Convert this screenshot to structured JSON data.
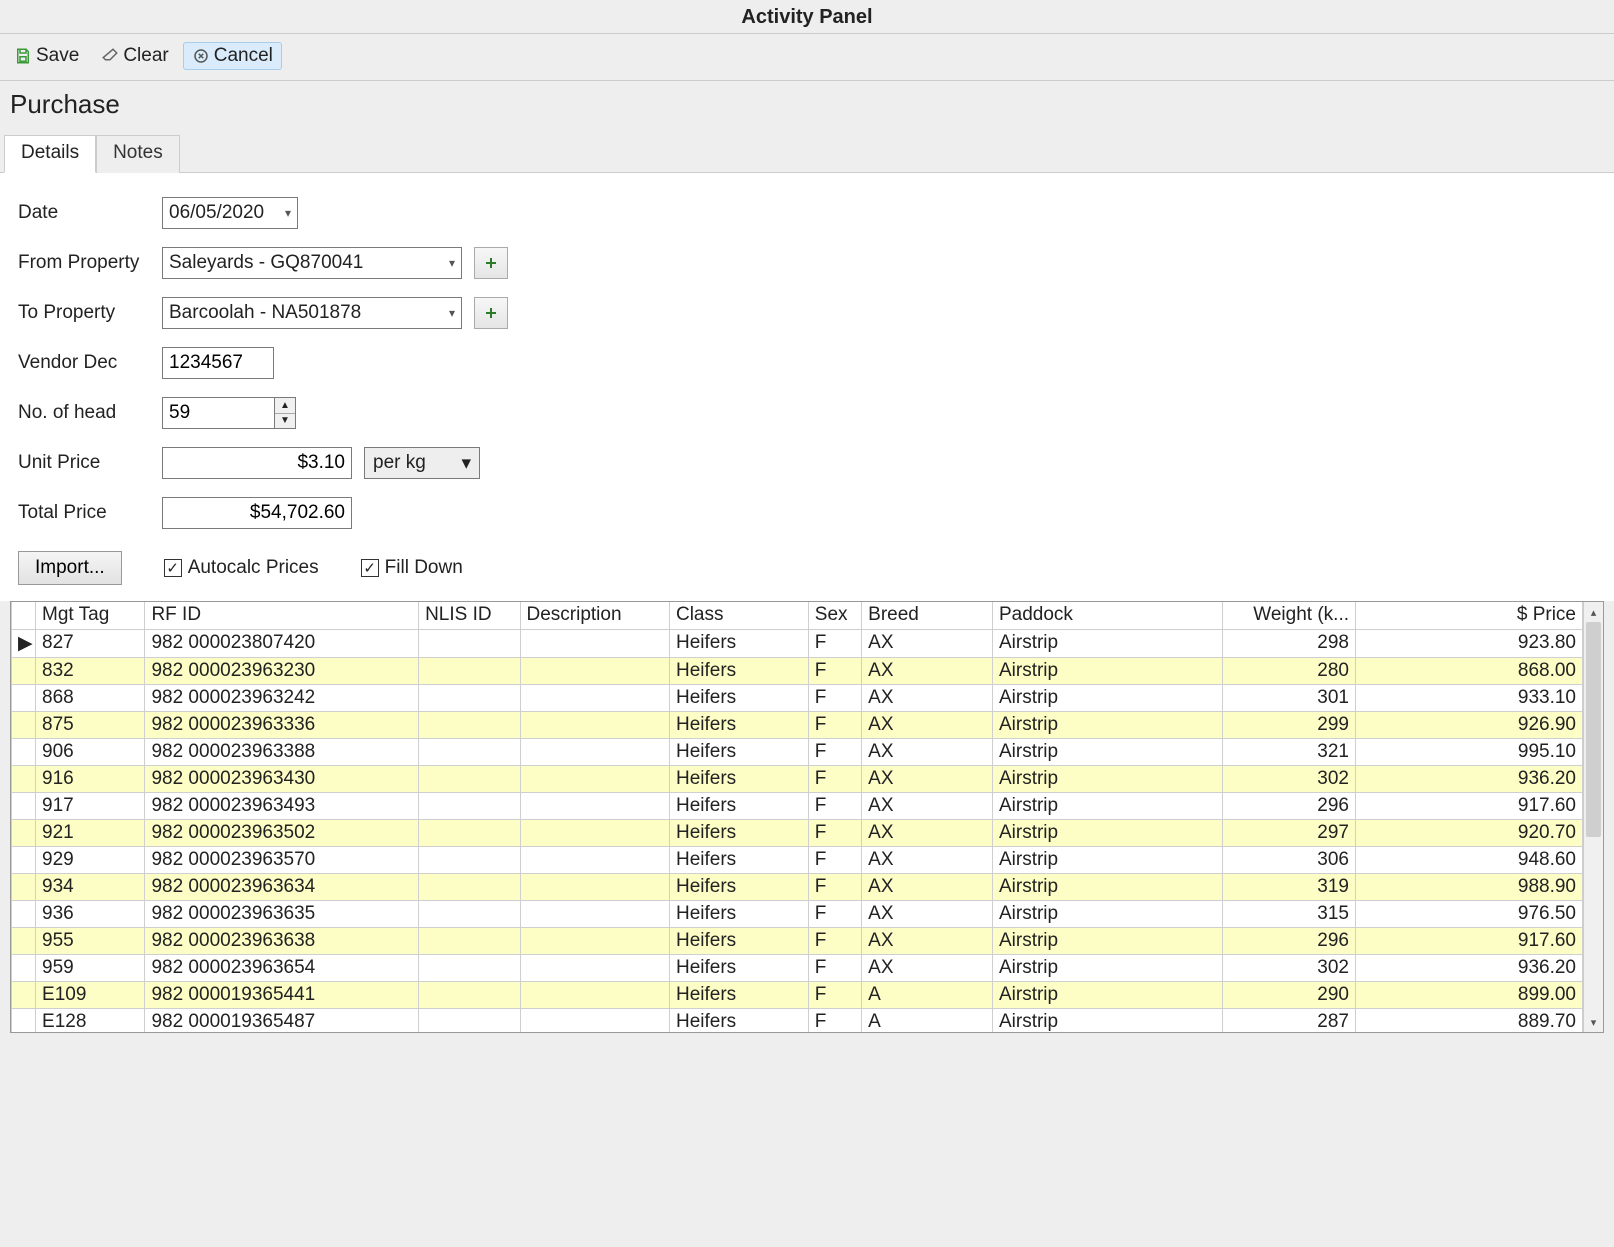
{
  "title": "Activity Panel",
  "toolbar": {
    "save": "Save",
    "clear": "Clear",
    "cancel": "Cancel"
  },
  "subtitle": "Purchase",
  "tabs": {
    "details": "Details",
    "notes": "Notes"
  },
  "form": {
    "date_label": "Date",
    "date_value": "06/05/2020",
    "from_label": "From Property",
    "from_value": "Saleyards - GQ870041",
    "to_label": "To Property",
    "to_value": "Barcoolah - NA501878",
    "vendor_label": "Vendor Dec",
    "vendor_value": "1234567",
    "head_label": "No. of head",
    "head_value": "59",
    "unit_price_label": "Unit Price",
    "unit_price_value": "$3.10",
    "unit_type": "per kg",
    "total_price_label": "Total Price",
    "total_price_value": "$54,702.60"
  },
  "actions": {
    "import": "Import...",
    "autocalc": "Autocalc Prices",
    "filldown": "Fill Down"
  },
  "grid": {
    "headers": {
      "mgt_tag": "Mgt Tag",
      "rf_id": "RF ID",
      "nlis_id": "NLIS ID",
      "description": "Description",
      "class": "Class",
      "sex": "Sex",
      "breed": "Breed",
      "paddock": "Paddock",
      "weight": "Weight (k...",
      "price": "$ Price"
    },
    "rows": [
      {
        "mgt": "827",
        "rfid": "982 000023807420",
        "nlis": "",
        "desc": "",
        "class": "Heifers",
        "sex": "F",
        "breed": "AX",
        "paddock": "Airstrip",
        "weight": "298",
        "price": "923.80"
      },
      {
        "mgt": "832",
        "rfid": "982 000023963230",
        "nlis": "",
        "desc": "",
        "class": "Heifers",
        "sex": "F",
        "breed": "AX",
        "paddock": "Airstrip",
        "weight": "280",
        "price": "868.00"
      },
      {
        "mgt": "868",
        "rfid": "982 000023963242",
        "nlis": "",
        "desc": "",
        "class": "Heifers",
        "sex": "F",
        "breed": "AX",
        "paddock": "Airstrip",
        "weight": "301",
        "price": "933.10"
      },
      {
        "mgt": "875",
        "rfid": "982 000023963336",
        "nlis": "",
        "desc": "",
        "class": "Heifers",
        "sex": "F",
        "breed": "AX",
        "paddock": "Airstrip",
        "weight": "299",
        "price": "926.90"
      },
      {
        "mgt": "906",
        "rfid": "982 000023963388",
        "nlis": "",
        "desc": "",
        "class": "Heifers",
        "sex": "F",
        "breed": "AX",
        "paddock": "Airstrip",
        "weight": "321",
        "price": "995.10"
      },
      {
        "mgt": "916",
        "rfid": "982 000023963430",
        "nlis": "",
        "desc": "",
        "class": "Heifers",
        "sex": "F",
        "breed": "AX",
        "paddock": "Airstrip",
        "weight": "302",
        "price": "936.20"
      },
      {
        "mgt": "917",
        "rfid": "982 000023963493",
        "nlis": "",
        "desc": "",
        "class": "Heifers",
        "sex": "F",
        "breed": "AX",
        "paddock": "Airstrip",
        "weight": "296",
        "price": "917.60"
      },
      {
        "mgt": "921",
        "rfid": "982 000023963502",
        "nlis": "",
        "desc": "",
        "class": "Heifers",
        "sex": "F",
        "breed": "AX",
        "paddock": "Airstrip",
        "weight": "297",
        "price": "920.70"
      },
      {
        "mgt": "929",
        "rfid": "982 000023963570",
        "nlis": "",
        "desc": "",
        "class": "Heifers",
        "sex": "F",
        "breed": "AX",
        "paddock": "Airstrip",
        "weight": "306",
        "price": "948.60"
      },
      {
        "mgt": "934",
        "rfid": "982 000023963634",
        "nlis": "",
        "desc": "",
        "class": "Heifers",
        "sex": "F",
        "breed": "AX",
        "paddock": "Airstrip",
        "weight": "319",
        "price": "988.90"
      },
      {
        "mgt": "936",
        "rfid": "982 000023963635",
        "nlis": "",
        "desc": "",
        "class": "Heifers",
        "sex": "F",
        "breed": "AX",
        "paddock": "Airstrip",
        "weight": "315",
        "price": "976.50"
      },
      {
        "mgt": "955",
        "rfid": "982 000023963638",
        "nlis": "",
        "desc": "",
        "class": "Heifers",
        "sex": "F",
        "breed": "AX",
        "paddock": "Airstrip",
        "weight": "296",
        "price": "917.60"
      },
      {
        "mgt": "959",
        "rfid": "982 000023963654",
        "nlis": "",
        "desc": "",
        "class": "Heifers",
        "sex": "F",
        "breed": "AX",
        "paddock": "Airstrip",
        "weight": "302",
        "price": "936.20"
      },
      {
        "mgt": "E109",
        "rfid": "982 000019365441",
        "nlis": "",
        "desc": "",
        "class": "Heifers",
        "sex": "F",
        "breed": "A",
        "paddock": "Airstrip",
        "weight": "290",
        "price": "899.00"
      },
      {
        "mgt": "E128",
        "rfid": "982 000019365487",
        "nlis": "",
        "desc": "",
        "class": "Heifers",
        "sex": "F",
        "breed": "A",
        "paddock": "Airstrip",
        "weight": "287",
        "price": "889.70"
      }
    ]
  }
}
